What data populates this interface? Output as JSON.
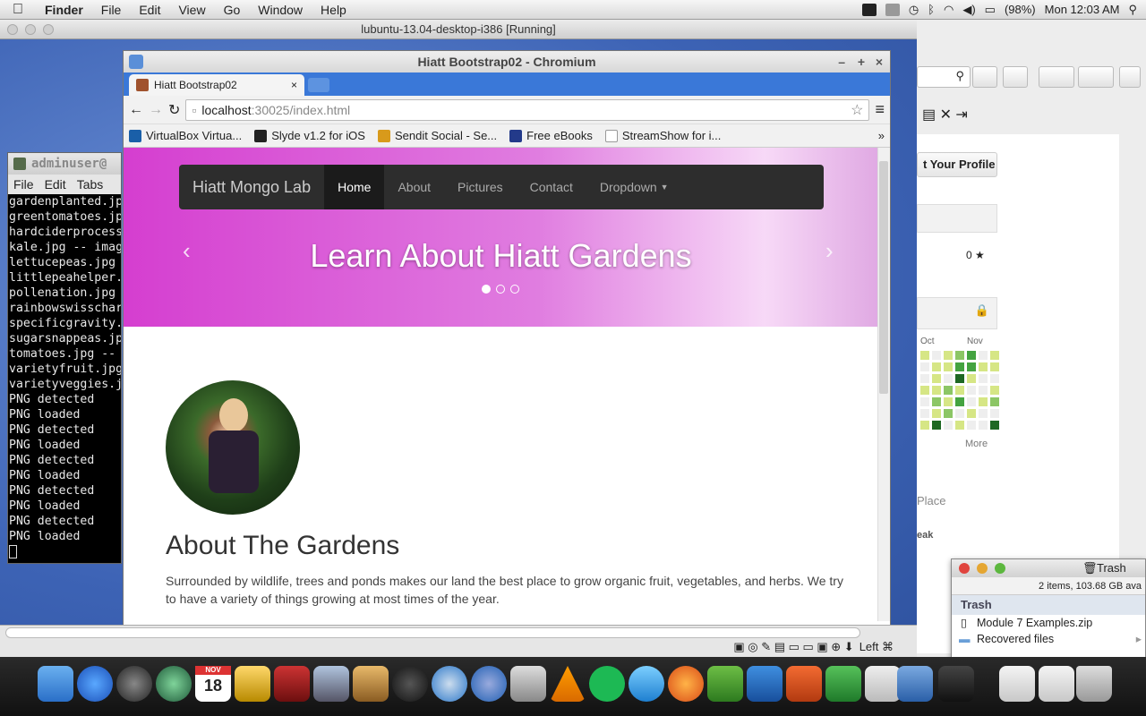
{
  "menubar": {
    "app": "Finder",
    "items": [
      "File",
      "Edit",
      "View",
      "Go",
      "Window",
      "Help"
    ],
    "battery": "(98%)",
    "clock": "Mon 12:03 AM"
  },
  "vbox": {
    "title": "lubuntu-13.04-desktop-i386 [Running]",
    "status_host_key": "Left ⌘"
  },
  "terminal": {
    "title": "adminuser@",
    "menu": [
      "File",
      "Edit",
      "Tabs"
    ],
    "lines": [
      "gardenplanted.jp",
      "greentomatoes.jp",
      "hardciderprocess",
      "kale.jpg -- imag",
      "lettucepeas.jpg",
      "littlepeahelper.",
      "pollenation.jpg",
      "rainbowswisschar",
      "specificgravity.",
      "sugarsnappeas.jp",
      "tomatoes.jpg --",
      "varietyfruit.jpg",
      "varietyveggies.j",
      "PNG detected",
      "PNG loaded",
      "PNG detected",
      "PNG loaded",
      "PNG detected",
      "PNG loaded",
      "PNG detected",
      "PNG loaded",
      "PNG detected",
      "PNG loaded"
    ]
  },
  "chromium": {
    "window_title": "Hiatt Bootstrap02 - Chromium",
    "tab_title": "Hiatt Bootstrap02",
    "url_host": "localhost",
    "url_rest": ":30025/index.html",
    "bookmarks": [
      "VirtualBox Virtua...",
      "Slyde v1.2 for iOS",
      "Sendit Social - Se...",
      "Free eBooks",
      "StreamShow for i..."
    ],
    "overflow": "»"
  },
  "site": {
    "brand": "Hiatt Mongo Lab",
    "nav": [
      "Home",
      "About",
      "Pictures",
      "Contact"
    ],
    "dropdown": "Dropdown",
    "hero_title": "Learn About Hiatt Gardens",
    "about_title": "About The Gardens",
    "about_text": "Surrounded by wildlife, trees and ponds makes our land the best place to grow organic fruit, vegetables, and herbs. We try to have a variety of things growing at most times of the year."
  },
  "background_browser": {
    "profile_button": "t Your Profile",
    "star_count": "0",
    "months": [
      "Oct",
      "Nov"
    ],
    "more": "More",
    "place": "Place",
    "eak": "eak"
  },
  "trash": {
    "title": "Trash",
    "info": "2 items, 103.68 GB ava",
    "header": "Trash",
    "items": [
      "Module 7 Examples.zip",
      "Recovered files"
    ]
  },
  "dock": {
    "calendar_month": "NOV",
    "calendar_day": "18"
  },
  "colors": {
    "hero_start": "#d53ed0",
    "navbar": "#2d2d2d",
    "tabstrip": "#3a78d8"
  }
}
